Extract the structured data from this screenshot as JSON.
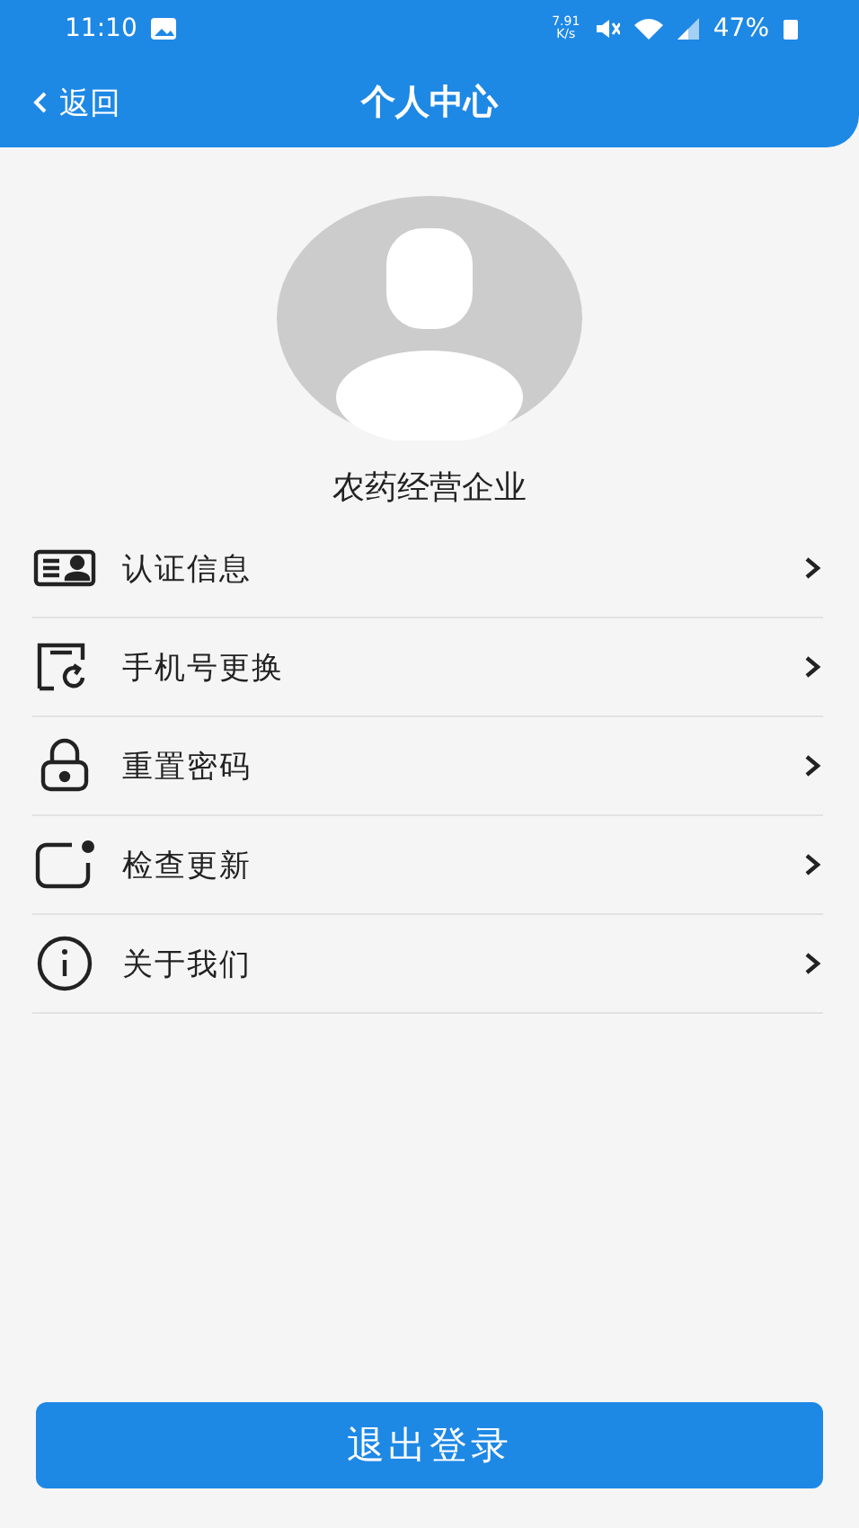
{
  "status_bar": {
    "time": "11:10",
    "speed": "7.91 K/s",
    "battery": "47%"
  },
  "header": {
    "back": "返回",
    "title": "个人中心"
  },
  "profile": {
    "name": "农药经营企业"
  },
  "menu": [
    {
      "kind": "id-card",
      "label": "认证信息"
    },
    {
      "kind": "phone",
      "label": "手机号更换"
    },
    {
      "kind": "lock",
      "label": "重置密码"
    },
    {
      "kind": "update",
      "label": "检查更新"
    },
    {
      "kind": "info",
      "label": "关于我们"
    }
  ],
  "logout": "退出登录"
}
